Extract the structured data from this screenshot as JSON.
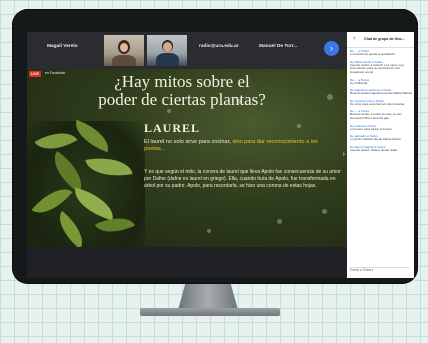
{
  "meet": {
    "participants": [
      {
        "name": "Magali Verelo"
      },
      {
        "name": "radio@ura.edu.ar"
      },
      {
        "name": "Manuel De Torr..."
      }
    ],
    "cam1_label": "",
    "cam2_label": ""
  },
  "slide": {
    "live_badge": "LIVE",
    "live_text": "en Facebook",
    "title_line1": "¿Hay mitos sobre el",
    "title_line2": "poder de ciertas plantas?",
    "section_title": "LAUREL",
    "para1_normal": "El laurel no solo sirve para cocinar,",
    "para1_highlight": "sino para dar reconocimiento a los poetas...",
    "para2": "Y es que según el mito, la corona de laurel que lleva Apolo fue consecuencia de su amor por Dafne (dafne es laurel en griego). Ella, cuando huía de Apolo, fue transformada en árbol por su padre. Apolo, para recordarla, se hizo una corona de estas hojas."
  },
  "chat": {
    "title": "Chat de grupo de Goo...",
    "messages": [
      {
        "from": "De ... a Todos",
        "text": "en Facebook queda la grabación"
      },
      {
        "from": "De Marta Ainza a Todos",
        "text": "buenas tardes a todos!!! Los mitos muy importantes para la construcción del imaginario social"
      },
      {
        "from": "De ... a Todos",
        "text": "Ay el Mandá"
      },
      {
        "from": "De Agustina Lafuente a Todos",
        "text": "Buenas tardes! Agustina desde Bahía Blanca"
      },
      {
        "from": "De Jimena Joris a Todos",
        "text": "Se sube para exportar las miles plantas"
      },
      {
        "from": "De ... a Todos",
        "text": "Buenas tardes a todos los que se van sumando!! Bien Jimena! jaja"
      },
      {
        "from": "De Andrea a Todos",
        "text": "el romero para atraer lo bueno"
      },
      {
        "from": "De gamad1 a Todos",
        "text": "un gusto todavía desde bahía blanca"
      },
      {
        "from": "De Elena Negrán a Todos",
        "text": "buenas tardes, Eliana desde Salta"
      }
    ],
    "input_placeholder": "Enviar a   Todos ▾"
  },
  "colors": {
    "screen_bg": "#202124",
    "accent_blue": "#3b78e7",
    "highlight_yellow": "#e8c020"
  }
}
